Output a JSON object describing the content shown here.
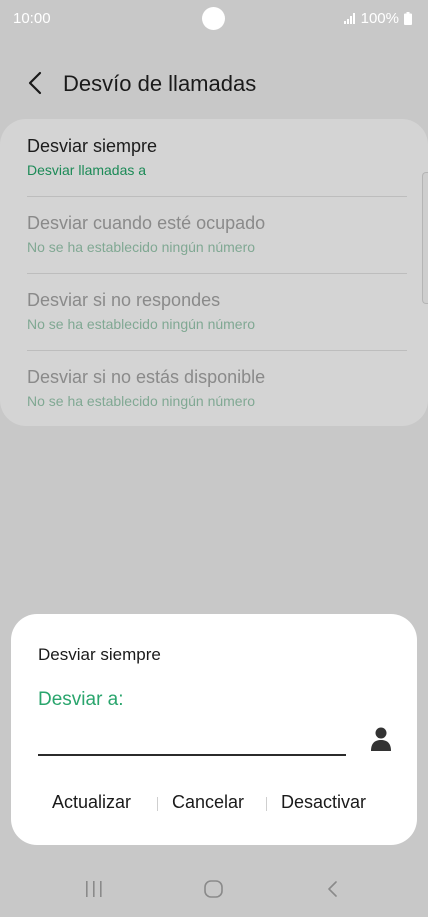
{
  "status_bar": {
    "time": "10:00",
    "battery": "100%"
  },
  "header": {
    "title": "Desvío de llamadas"
  },
  "settings": [
    {
      "title": "Desviar siempre",
      "subtitle": "Desviar llamadas a"
    },
    {
      "title": "Desviar cuando esté ocupado",
      "subtitle": "No se ha establecido ningún número"
    },
    {
      "title": "Desviar si no respondes",
      "subtitle": "No se ha establecido ningún número"
    },
    {
      "title": "Desviar si no estás disponible",
      "subtitle": "No se ha establecido ningún número"
    }
  ],
  "dialog": {
    "title": "Desviar siempre",
    "label": "Desviar a:",
    "input_value": "",
    "actions": {
      "update": "Actualizar",
      "cancel": "Cancelar",
      "deactivate": "Desactivar"
    }
  },
  "colors": {
    "accent": "#2aa56d",
    "subtitle_green": "#1c8a57"
  }
}
